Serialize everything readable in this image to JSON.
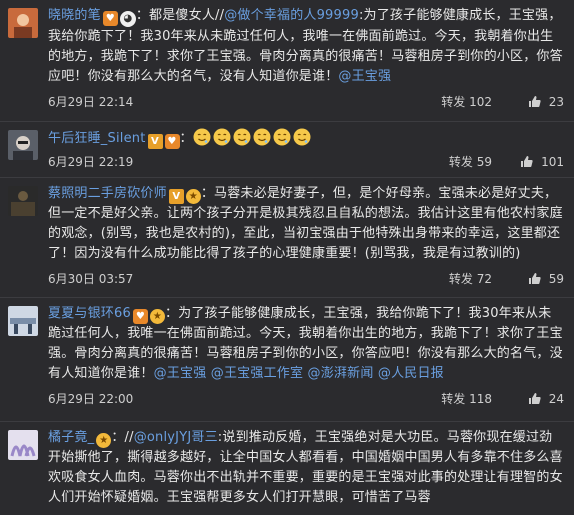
{
  "comments": [
    {
      "user": "晓晓的笔",
      "avatar_color": "#c86a3c",
      "segments": [
        {
          "t": "text",
          "v": "："
        },
        {
          "t": "text",
          "v": "都是傻女人//"
        },
        {
          "t": "mention",
          "v": "@做个幸福的人99999"
        },
        {
          "t": "text",
          "v": ":为了孩子能够健康成长，王宝强，我给你跪下了！我30年来从未跪过任何人，我唯一在佛面前跪过。今天，我朝着你出生的地方，我跪下了！求你了王宝强。骨肉分离真的很痛苦！马蓉租房子到你的小区，你答应吧！你没有那么大的名气，没有人知道你是谁！"
        },
        {
          "t": "mention",
          "v": "@王宝强"
        }
      ],
      "time": "6月29日 22:14",
      "repost": "转发 102",
      "likes": "23"
    },
    {
      "user": "午后狂睡_Silent",
      "avatar_color": "#5a5f68",
      "segments": [
        {
          "t": "text",
          "v": "："
        }
      ],
      "emoji_count": 6,
      "time": "6月29日 22:19",
      "repost": "转发 59",
      "likes": "101"
    },
    {
      "user": "蔡照明二手房砍价师",
      "avatar_color": "#2a2a2a",
      "segments": [
        {
          "t": "text",
          "v": "：马蓉未必是好妻子，但，是个好母亲。宝强未必是好丈夫，但一定不是好父亲。让两个孩子分开是极其残忍且自私的想法。我估计这里有他农村家庭的观念，(别骂，我也是农村的)，至此，当初宝强由于他特殊出身带来的幸运，这里都还了！因为没有什么成功能比得了孩子的心理健康重要！(别骂我，我是有过教训的)"
        }
      ],
      "time": "6月30日 03:57",
      "repost": "转发 72",
      "likes": "59"
    },
    {
      "user": "夏夏与银环66",
      "avatar_color": "#7a8ea8",
      "segments": [
        {
          "t": "text",
          "v": "：为了孩子能够健康成长，王宝强，我给你跪下了！我30年来从未跪过任何人，我唯一在佛面前跪过。今天，我朝着你出生的地方，我跪下了！求你了王宝强。骨肉分离真的很痛苦！马蓉租房子到你的小区，你答应吧！你没有那么大的名气，没有人知道你是谁！"
        },
        {
          "t": "mention",
          "v": "@王宝强"
        },
        {
          "t": "text",
          "v": " "
        },
        {
          "t": "mention",
          "v": "@王宝强工作室"
        },
        {
          "t": "text",
          "v": " "
        },
        {
          "t": "mention",
          "v": "@澎湃新闻"
        },
        {
          "t": "text",
          "v": " "
        },
        {
          "t": "mention",
          "v": "@人民日报"
        }
      ],
      "time": "6月29日 22:00",
      "repost": "转发 118",
      "likes": "24"
    },
    {
      "user": "橘子竟_",
      "avatar_color": "#9a88c8",
      "segments": [
        {
          "t": "text",
          "v": "：//"
        },
        {
          "t": "mention",
          "v": "@onlyJYJ哥三"
        },
        {
          "t": "text",
          "v": ":说到推动反婚，王宝强绝对是大功臣。马蓉你现在缓过劲开始撕他了，撕得越多越好，让全中国女人都看看，中国婚姻中国男人有多靠不住多么喜欢吸食女人血肉。马蓉你出不出轨并不重要，重要的是王宝强对此事的处理让有理智的女人们开始怀疑婚姻。王宝强帮更多女人们打开慧眼，可惜苦了马蓉"
        }
      ],
      "time": "",
      "repost": "",
      "likes": ""
    }
  ]
}
